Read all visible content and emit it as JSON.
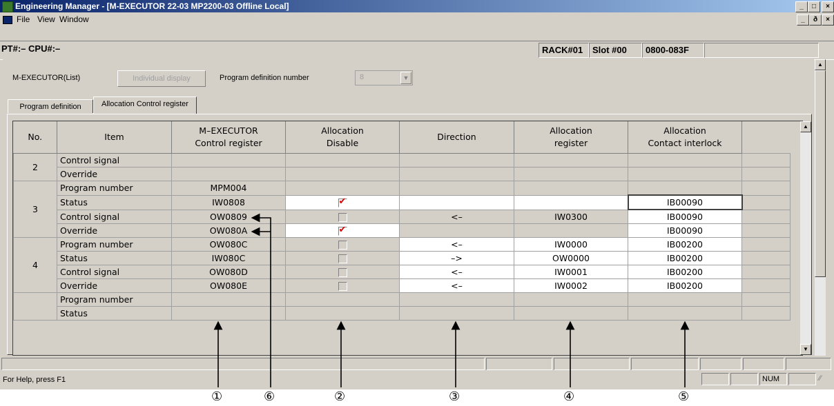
{
  "window": {
    "title": "Engineering Manager - [M-EXECUTOR   22-03   MP2200-03 Offline  Local]",
    "controls": {
      "minimize": "_",
      "restore": "□",
      "close": "×"
    },
    "mdi_controls": {
      "minimize": "_",
      "restore": "ð",
      "close": "×"
    }
  },
  "menu": [
    "File",
    "View",
    "Window"
  ],
  "infobar": {
    "pt_cpu": "PT#:– CPU#:–",
    "rack": "RACK#01",
    "slot": "Slot #00",
    "address": "0800-083F"
  },
  "toolbar": {
    "list_label": "M-EXECUTOR(List)",
    "individual_button": "Individual display",
    "program_def_label": "Program definition number",
    "program_def_value": "8"
  },
  "tabs": [
    "Program definition",
    "Allocation Control register"
  ],
  "grid": {
    "headers": [
      [
        "No."
      ],
      [
        "Item"
      ],
      [
        "M–EXECUTOR",
        "Control register"
      ],
      [
        "Allocation",
        "Disable"
      ],
      [
        "Direction"
      ],
      [
        "Allocation",
        "register"
      ],
      [
        "Allocation",
        "Contact interlock"
      ]
    ],
    "groups": [
      {
        "no": "2",
        "rows": [
          {
            "item": "Control signal",
            "reg": "",
            "disable": null,
            "dir": "",
            "alloc": "",
            "contact": ""
          },
          {
            "item": "Override",
            "reg": "",
            "disable": null,
            "dir": "",
            "alloc": "",
            "contact": ""
          }
        ]
      },
      {
        "no": "3",
        "rows": [
          {
            "item": "Program number",
            "reg": "MPM004",
            "disable": null,
            "dir": "",
            "alloc": "",
            "contact": ""
          },
          {
            "item": "Status",
            "reg": "IW0808",
            "disable": true,
            "dir": "",
            "alloc": "",
            "contact": "IB00090"
          },
          {
            "item": "Control signal",
            "reg": "OW0809",
            "disable": false,
            "dir": "<–",
            "alloc": "IW0300",
            "contact": "IB00090"
          },
          {
            "item": "Override",
            "reg": "OW080A",
            "disable": true,
            "dir": "",
            "alloc": "",
            "contact": "IB00090"
          }
        ]
      },
      {
        "no": "4",
        "rows": [
          {
            "item": "Program number",
            "reg": "OW080C",
            "disable": false,
            "dir": "<–",
            "alloc": "IW0000",
            "contact": "IB00200"
          },
          {
            "item": "Status",
            "reg": "IW080C",
            "disable": false,
            "dir": "–>",
            "alloc": "OW0000",
            "contact": "IB00200"
          },
          {
            "item": "Control signal",
            "reg": "OW080D",
            "disable": false,
            "dir": "<–",
            "alloc": "IW0001",
            "contact": "IB00200"
          },
          {
            "item": "Override",
            "reg": "OW080E",
            "disable": false,
            "dir": "<–",
            "alloc": "IW0002",
            "contact": "IB00200"
          }
        ]
      },
      {
        "no": "",
        "rows": [
          {
            "item": "Program number",
            "reg": "",
            "disable": null,
            "dir": "",
            "alloc": "",
            "contact": ""
          },
          {
            "item": "Status",
            "reg": "",
            "disable": null,
            "dir": "",
            "alloc": "",
            "contact": ""
          }
        ]
      }
    ]
  },
  "status": {
    "help": "For Help, press F1",
    "num": "NUM"
  },
  "annotations": [
    "①",
    "⑥",
    "②",
    "③",
    "④",
    "⑤"
  ]
}
